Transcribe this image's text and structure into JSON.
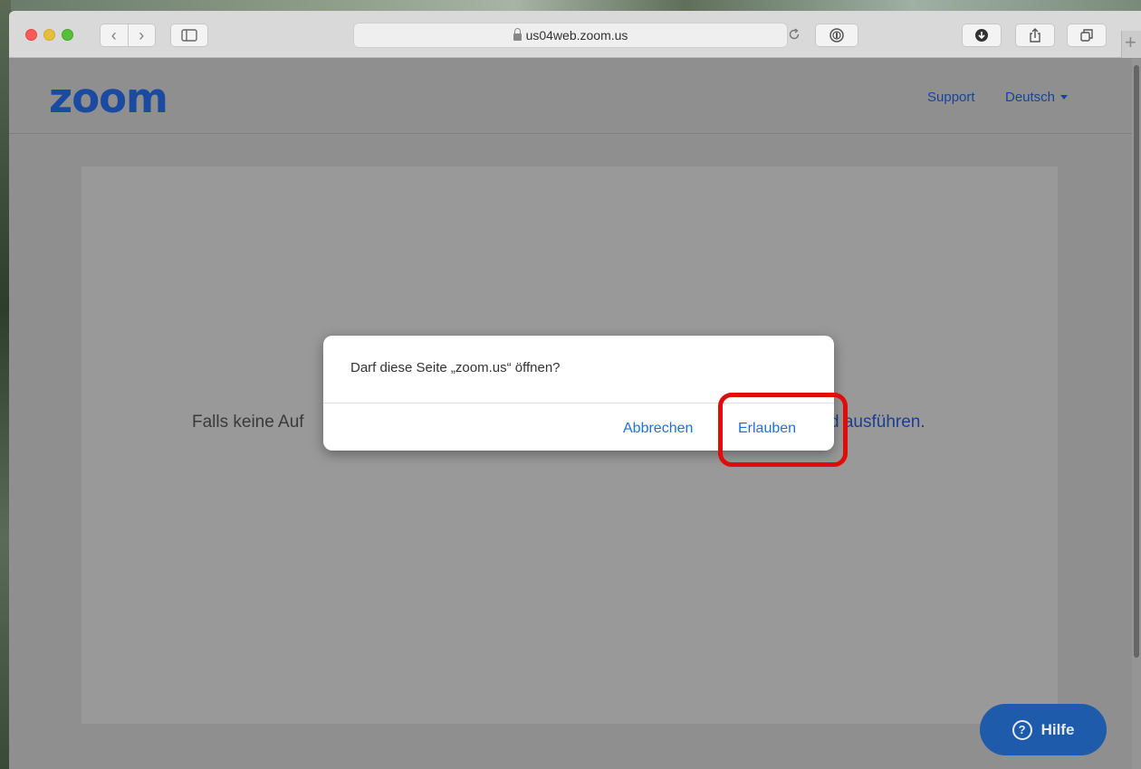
{
  "browser": {
    "url": "us04web.zoom.us",
    "nav_back_glyph": "‹",
    "nav_forward_glyph": "›",
    "new_tab_glyph": "+"
  },
  "header": {
    "logo": "zoom",
    "support_label": "Support",
    "language_label": "Deutsch"
  },
  "page": {
    "text_left": "Falls keine Auf",
    "text_right": "d ausführen",
    "text_right_end": "."
  },
  "dialog": {
    "message": "Darf diese Seite „zoom.us“ öffnen?",
    "cancel_label": "Abbrechen",
    "allow_label": "Erlauben"
  },
  "help": {
    "label": "Hilfe",
    "icon_glyph": "?"
  },
  "colors": {
    "zoom_blue": "#1a4ba0",
    "dialog_button": "#1d72d8",
    "highlight": "#e10b0b"
  }
}
